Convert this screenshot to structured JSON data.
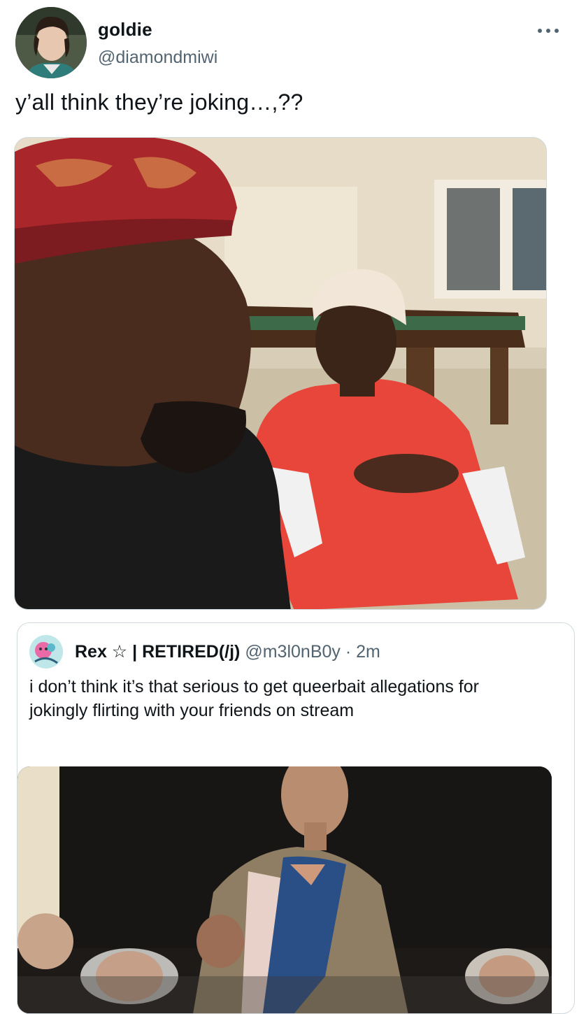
{
  "tweet": {
    "display_name": "goldie",
    "handle": "@diamondmiwi",
    "text": "y’all think they’re joking…,??",
    "more_icon": "more-horizontal-icon",
    "media_description_icon": "photo"
  },
  "quote": {
    "display_name": "Rex ☆ | RETIRED(/j)",
    "handle": "@m3l0nB0y",
    "separator": "·",
    "time": "2m",
    "text": "i don’t think it’s that serious to get queerbait allegations for jokingly flirting with your friends on stream"
  },
  "colors": {
    "primary_text": "#0f1419",
    "secondary_text": "#536471",
    "border": "#cfd9de"
  }
}
